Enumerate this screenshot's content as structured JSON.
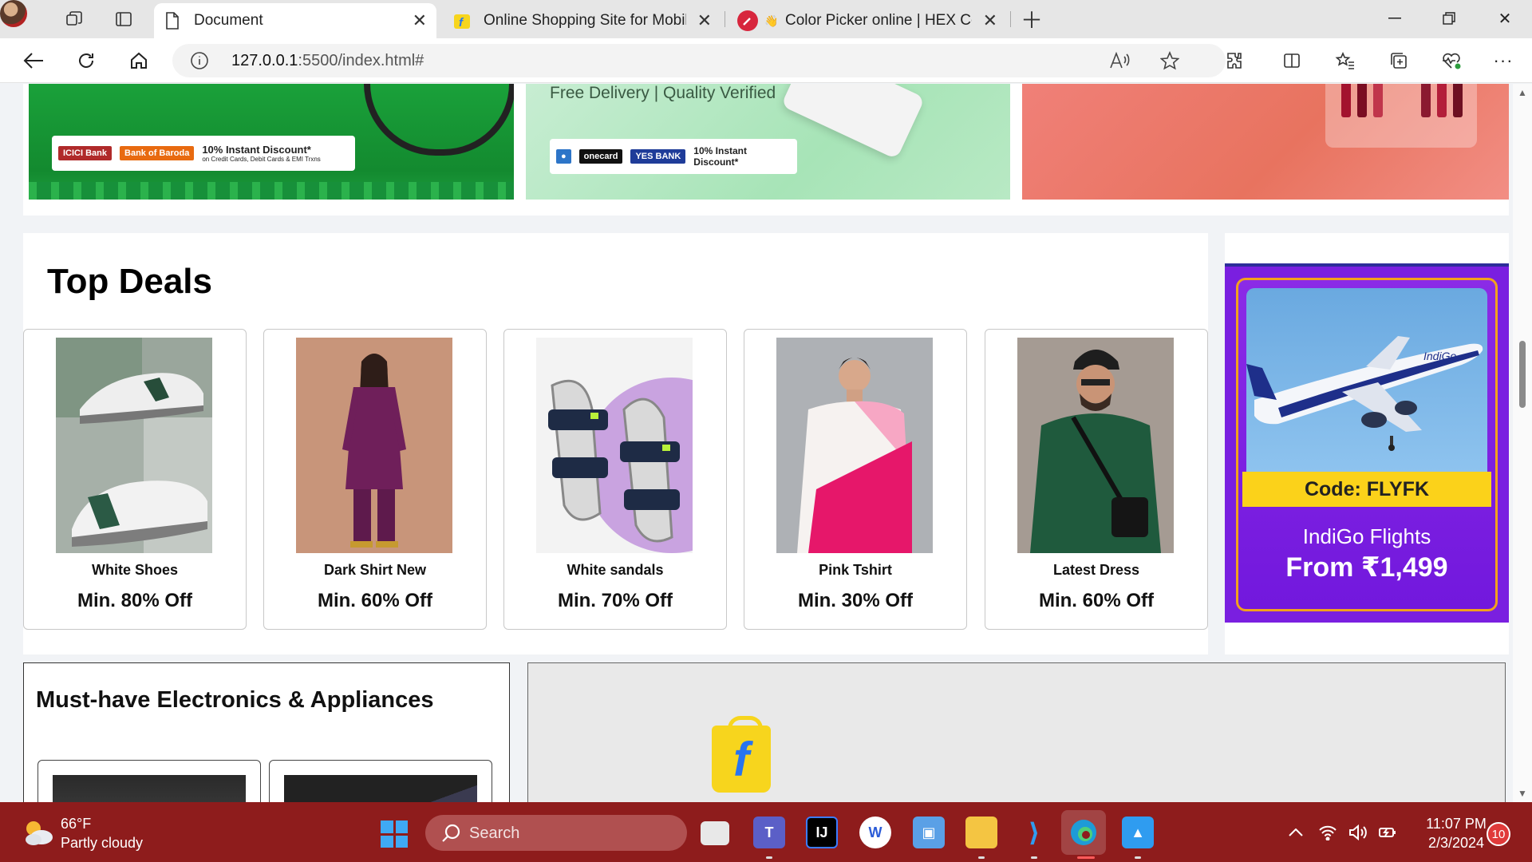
{
  "browser": {
    "tabs": [
      {
        "title": "Document",
        "active": true
      },
      {
        "title": "Online Shopping Site for Mobiles",
        "active": false
      },
      {
        "title": "Color Picker online | HEX Colo",
        "active": false
      }
    ],
    "url_host": "127.0.0.1",
    "url_rest": ":5500/index.html#"
  },
  "banners": {
    "banner1": {
      "bank1": "ICICI Bank",
      "bank2": "Bank of Baroda",
      "offer": "10% Instant Discount*",
      "offer_sub": "on Credit Cards, Debit Cards & EMI Trxns"
    },
    "banner2": {
      "headline": "Free Delivery | Quality Verified",
      "bank1": "onecard",
      "bank2": "YES BANK",
      "offer": "10% Instant Discount*"
    }
  },
  "top_deals": {
    "title": "Top Deals",
    "items": [
      {
        "name": "White Shoes",
        "discount": "Min. 80% Off"
      },
      {
        "name": "Dark Shirt New",
        "discount": "Min. 60% Off"
      },
      {
        "name": "White sandals",
        "discount": "Min. 70% Off"
      },
      {
        "name": "Pink Tshirt",
        "discount": "Min. 30% Off"
      },
      {
        "name": "Latest Dress",
        "discount": "Min. 60% Off"
      }
    ]
  },
  "ad": {
    "code": "Code: FLYFK",
    "line1": "IndiGo Flights",
    "line2": "From ₹1,499",
    "plane_label": "IndiGo"
  },
  "electronics": {
    "title": "Must-have Electronics & Appliances"
  },
  "promo": {
    "logo_letter": "f"
  },
  "taskbar": {
    "weather_temp": "66°F",
    "weather_desc": "Partly cloudy",
    "search_placeholder": "Search",
    "time": "11:07 PM",
    "date": "2/3/2024",
    "notifications": "10"
  },
  "colors": {
    "taskbar_bg": "#8e1c1c",
    "ad_purple": "#7a1fe0",
    "ad_code_yellow": "#fbd21a",
    "flipkart_yellow": "#f7d51d",
    "flipkart_blue": "#2874f0"
  },
  "icons": [
    "back-icon",
    "refresh-icon",
    "home-icon",
    "info-icon",
    "read-aloud-icon",
    "favorite-star-icon",
    "extensions-icon",
    "split-screen-icon",
    "favorites-icon",
    "collections-icon",
    "browser-essentials-icon",
    "more-icon"
  ]
}
